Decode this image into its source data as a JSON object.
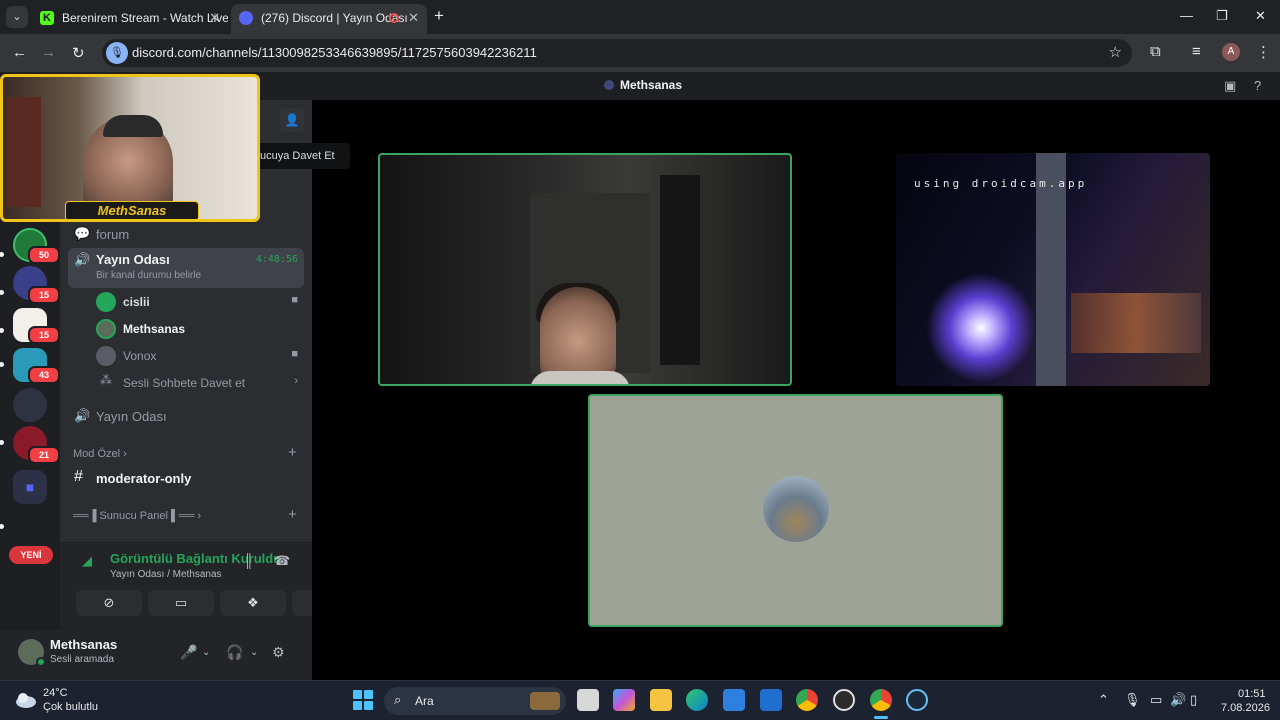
{
  "browser": {
    "tabs": [
      {
        "title": "Berenirem Stream - Watch Live",
        "favicon": "K"
      },
      {
        "title": "(276) Discord | Yayın Odası",
        "favicon_badge": "276"
      }
    ],
    "new_tab": "+",
    "url": "discord.com/channels/1130098253346639895/1172575603942236211"
  },
  "discord": {
    "top_title": "Methsanas",
    "tooltip": "ucuya Davet Et",
    "servers": [
      {
        "badge": "50",
        "color": "#1f7a3a"
      },
      {
        "badge": "15",
        "color": "#3a3f8a"
      },
      {
        "badge": "15",
        "color": "#f2efe8"
      },
      {
        "badge": "43",
        "color": "#2a9ab8"
      },
      {
        "badge": "",
        "color": "#2d3340"
      },
      {
        "badge": "21",
        "color": "#8a1a2a"
      },
      {
        "badge": "",
        "color": "#5865f2"
      }
    ],
    "new_label": "YENİ",
    "channels": {
      "forum": "forum",
      "active_voice": {
        "name": "Yayın Odası",
        "status": "Bir kanal durumu belirle",
        "timer": "4:48:56"
      },
      "users": [
        "cislii",
        "Methsanas",
        "Vonox"
      ],
      "invite": "Sesli Sohbete Davet et",
      "voice2": "Yayın Odası",
      "category_mod": "Mod Özel",
      "mod_channel": "moderator-only",
      "category_panel": "══▐ Sunucu Panel ▌══"
    },
    "voice": {
      "status": "Görüntülü Bağlantı Kuruldu",
      "sub": "Yayın Odası / Methsanas"
    },
    "user": {
      "name": "Methsanas",
      "status": "Sesli aramada"
    },
    "stream_watermark": "using droidcam.app",
    "webcam_banner": "MethSanas"
  },
  "taskbar": {
    "temp": "24°C",
    "weather": "Çok bulutlu",
    "search": "Ara",
    "time": "01:51",
    "date": "7.08.2026"
  }
}
